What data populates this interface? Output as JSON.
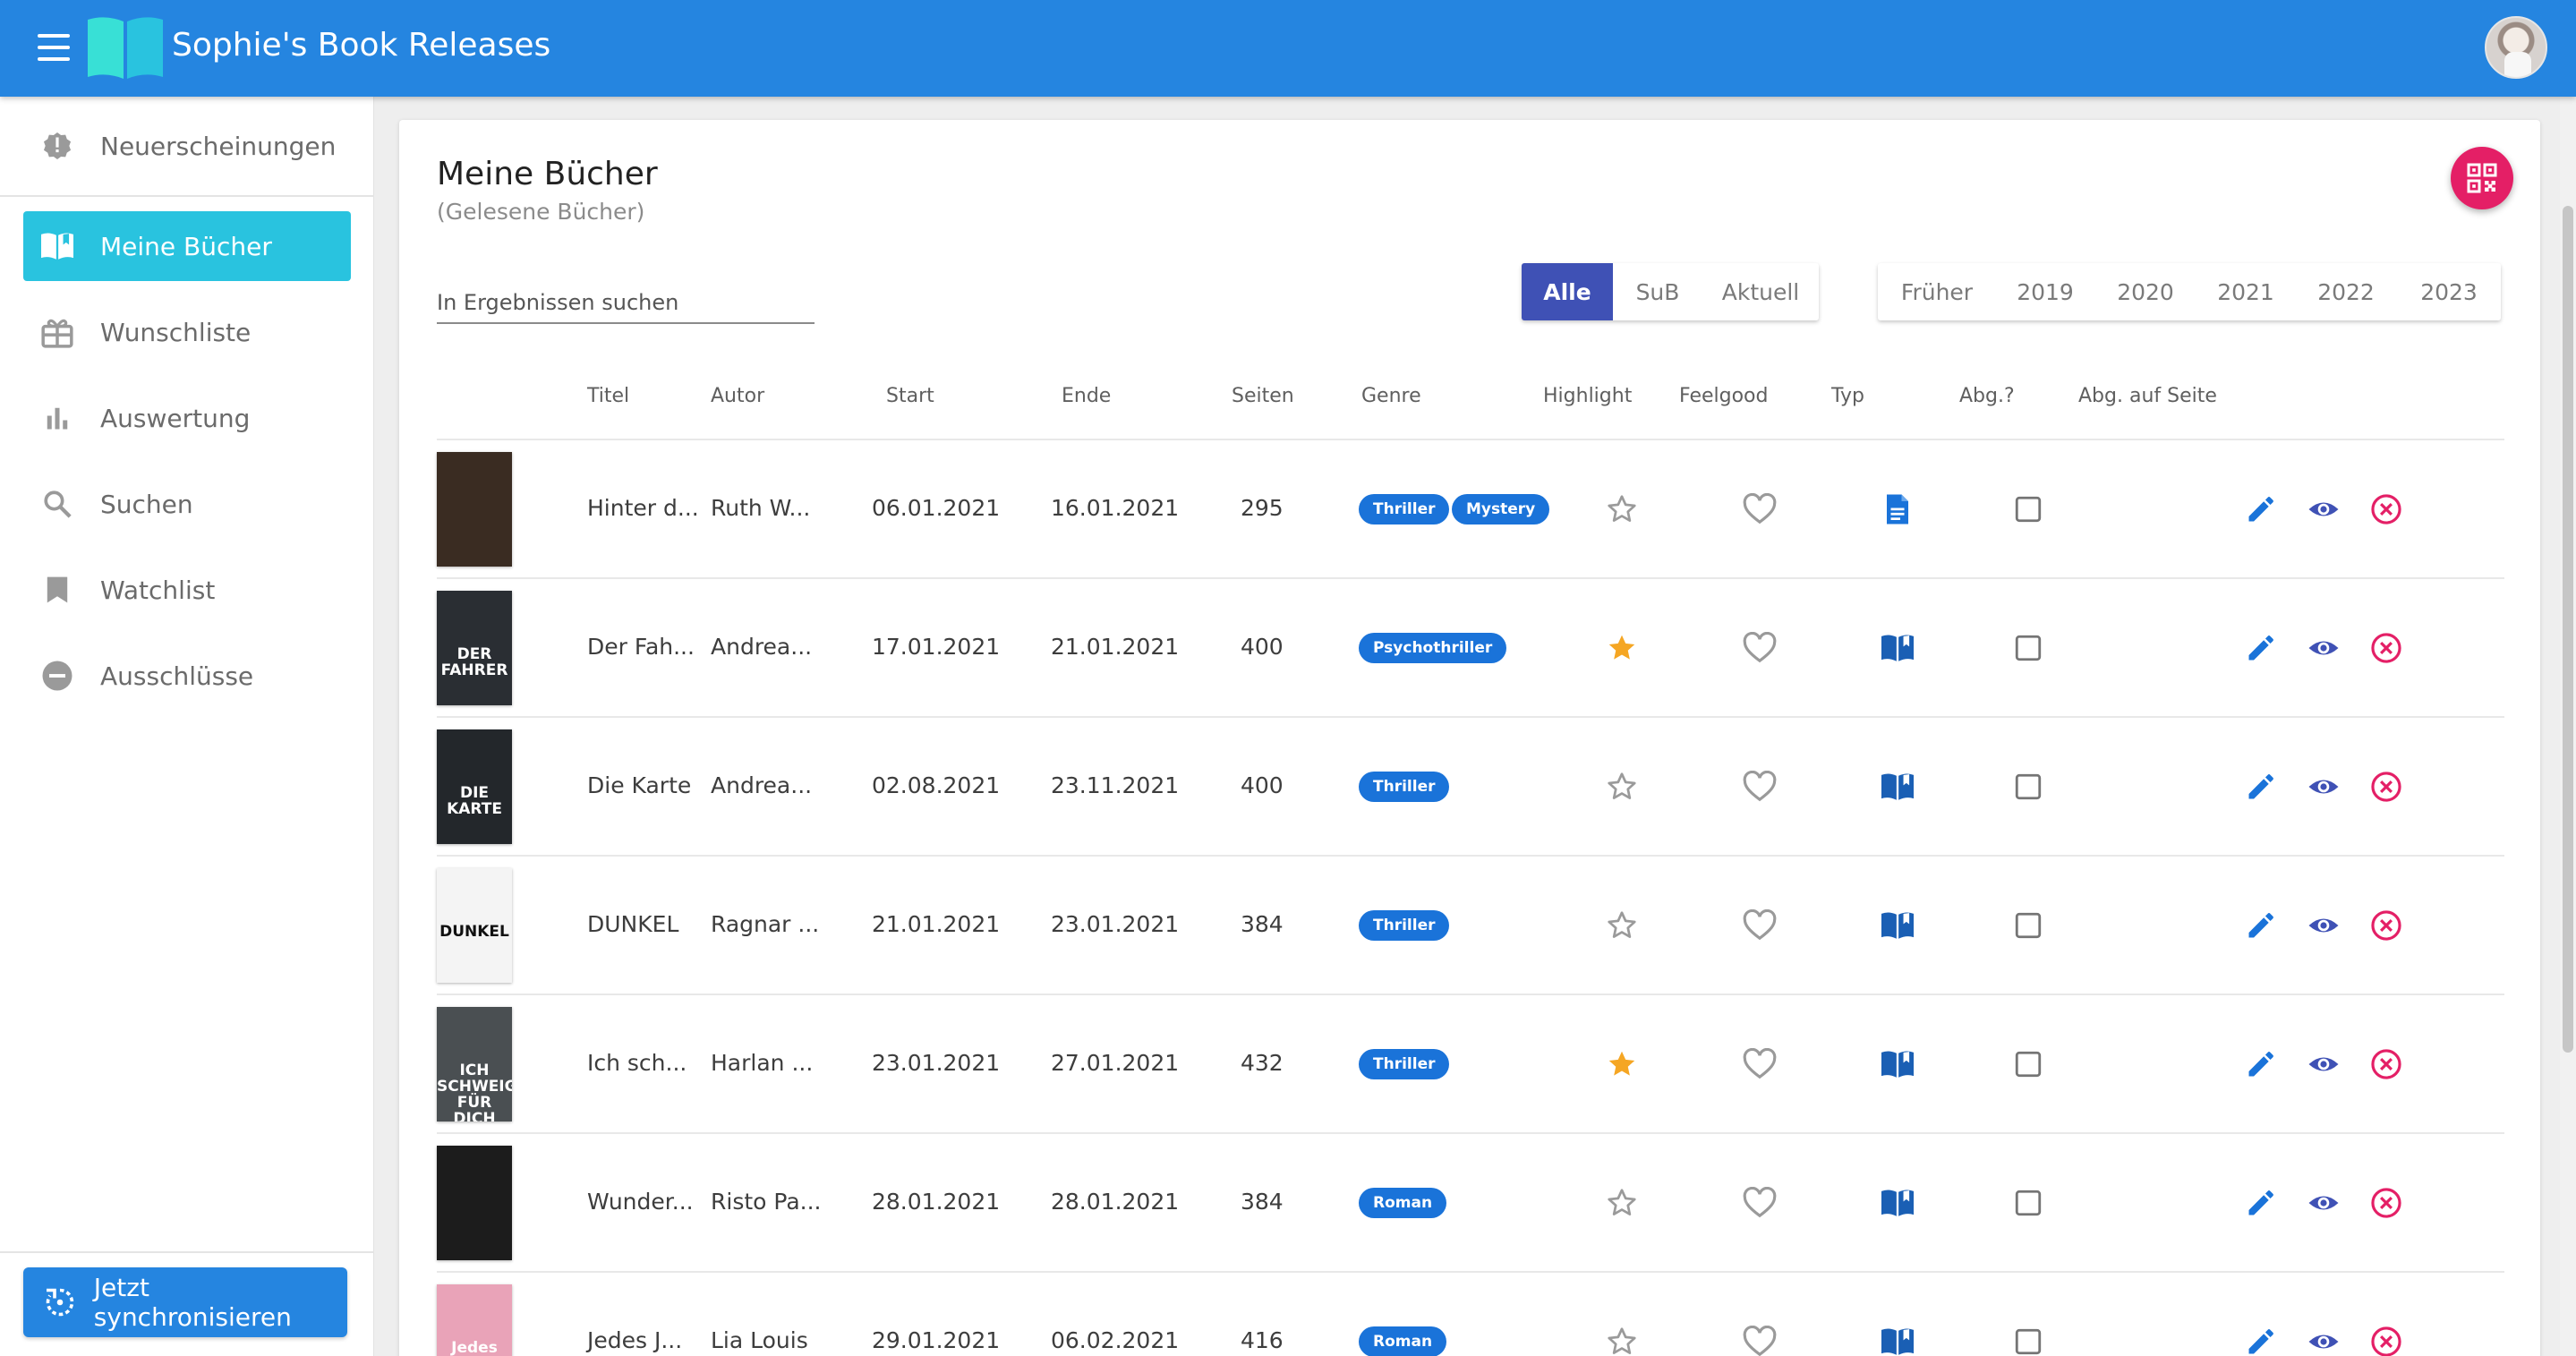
{
  "app": {
    "title": "Sophie's Book Releases"
  },
  "sidebar": {
    "items": [
      {
        "label": "Neuerscheinungen",
        "icon": "alert-badge-icon",
        "active": false
      },
      {
        "label": "Meine Bücher",
        "icon": "open-book-icon",
        "active": true
      },
      {
        "label": "Wunschliste",
        "icon": "gift-icon",
        "active": false
      },
      {
        "label": "Auswertung",
        "icon": "bar-chart-icon",
        "active": false
      },
      {
        "label": "Suchen",
        "icon": "search-icon",
        "active": false
      },
      {
        "label": "Watchlist",
        "icon": "bookmark-icon",
        "active": false
      },
      {
        "label": "Ausschlüsse",
        "icon": "minus-circle-icon",
        "active": false
      }
    ],
    "sync_label": "Jetzt synchronisieren"
  },
  "main": {
    "title": "Meine Bücher",
    "subtitle": "(Gelesene Bücher)",
    "search": {
      "placeholder": "In Ergebnissen suchen",
      "value": ""
    },
    "status_filter": {
      "options": [
        "Alle",
        "SuB",
        "Aktuell"
      ],
      "selected": "Alle"
    },
    "year_filter": {
      "options": [
        "Früher",
        "2019",
        "2020",
        "2021",
        "2022",
        "2023"
      ]
    },
    "columns": [
      "Titel",
      "Autor",
      "Start",
      "Ende",
      "Seiten",
      "Genre",
      "Highlight",
      "Feelgood",
      "Typ",
      "Abg.?",
      "Abg. auf Seite"
    ]
  },
  "books": [
    {
      "title": "Hinter d...",
      "author": "Ruth W...",
      "start": "06.01.2021",
      "end": "16.01.2021",
      "pages": "295",
      "genres": [
        "Thriller",
        "Mystery"
      ],
      "highlight": false,
      "type": "ebook",
      "cover_color": "#3a2c22",
      "cover_text": ""
    },
    {
      "title": "Der Fah...",
      "author": "Andrea...",
      "start": "17.01.2021",
      "end": "21.01.2021",
      "pages": "400",
      "genres": [
        "Psychothriller"
      ],
      "highlight": true,
      "type": "book",
      "cover_color": "#2a2e33",
      "cover_text": "DER FAHRER"
    },
    {
      "title": "Die Karte",
      "author": "Andrea...",
      "start": "02.08.2021",
      "end": "23.11.2021",
      "pages": "400",
      "genres": [
        "Thriller"
      ],
      "highlight": false,
      "type": "book",
      "cover_color": "#23272b",
      "cover_text": "DIE KARTE"
    },
    {
      "title": "DUNKEL",
      "author": "Ragnar ...",
      "start": "21.01.2021",
      "end": "23.01.2021",
      "pages": "384",
      "genres": [
        "Thriller"
      ],
      "highlight": false,
      "type": "book",
      "cover_color": "#f4f4f4",
      "cover_text": "DUNKEL"
    },
    {
      "title": "Ich sch...",
      "author": "Harlan ...",
      "start": "23.01.2021",
      "end": "27.01.2021",
      "pages": "432",
      "genres": [
        "Thriller"
      ],
      "highlight": true,
      "type": "book",
      "cover_color": "#4a4f52",
      "cover_text": "ICH SCHWEIGE FÜR DICH"
    },
    {
      "title": "Wunder...",
      "author": "Risto Pa...",
      "start": "28.01.2021",
      "end": "28.01.2021",
      "pages": "384",
      "genres": [
        "Roman"
      ],
      "highlight": false,
      "type": "book",
      "cover_color": "#1c1c1c",
      "cover_text": ""
    },
    {
      "title": "Jedes J...",
      "author": "Lia Louis",
      "start": "29.01.2021",
      "end": "06.02.2021",
      "pages": "416",
      "genres": [
        "Roman"
      ],
      "highlight": false,
      "type": "book",
      "cover_color": "#e9a3b8",
      "cover_text": "Jedes Jahr im"
    }
  ],
  "colors": {
    "topbar": "#2585e0",
    "active_nav": "#29c3df",
    "chip": "#1a73d9",
    "star_filled": "#f5a623",
    "edit": "#1a73d9",
    "view": "#3f51b5",
    "delete": "#e41f66",
    "fab": "#e41f66"
  }
}
